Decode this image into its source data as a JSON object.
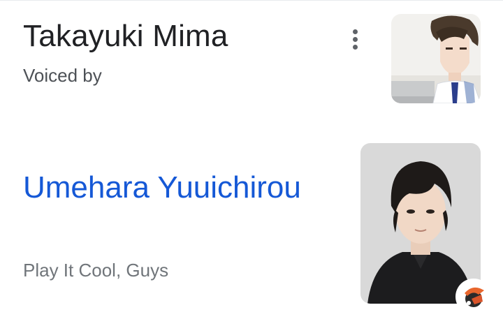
{
  "character": {
    "name": "Takayuki Mima",
    "relation": "Voiced by",
    "thumb_icon": "anime-character-thumbnail"
  },
  "menu": {
    "icon": "more-vert-icon"
  },
  "actor": {
    "name": "Umehara Yuuichirou",
    "work": "Play It Cool, Guys",
    "photo_icon": "voice-actor-photo"
  },
  "badge": {
    "icon": "source-app-badge-icon"
  },
  "colors": {
    "title": "#202124",
    "secondary": "#4d5156",
    "link": "#1558d6",
    "muted": "#70757a"
  }
}
